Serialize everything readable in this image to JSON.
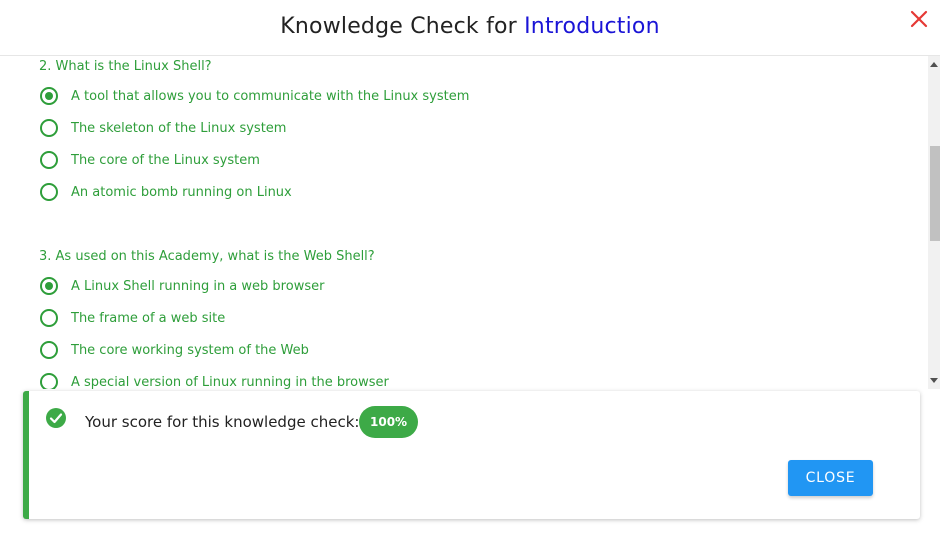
{
  "header": {
    "title_prefix": "Knowledge Check for ",
    "title_accent": "Introduction",
    "close_icon": "close-icon"
  },
  "questions": [
    {
      "text": "2. What is the Linux Shell?",
      "options": [
        {
          "label": "A tool that allows you to communicate with the Linux system",
          "checked": true
        },
        {
          "label": "The skeleton of the Linux system",
          "checked": false
        },
        {
          "label": "The core of the Linux system",
          "checked": false
        },
        {
          "label": "An atomic bomb running on Linux",
          "checked": false
        }
      ]
    },
    {
      "text": "3. As used on this Academy, what is the Web Shell?",
      "options": [
        {
          "label": "A Linux Shell running in a web browser",
          "checked": true
        },
        {
          "label": "The frame of a web site",
          "checked": false
        },
        {
          "label": "The core working system of the Web",
          "checked": false
        },
        {
          "label": "A special version of Linux running in the browser",
          "checked": false
        }
      ]
    }
  ],
  "result": {
    "icon": "check-circle-icon",
    "score_text": "Your score for this knowledge check:",
    "score_value": "100%",
    "close_label": "CLOSE"
  },
  "colors": {
    "accent_blue": "#1a14d6",
    "green": "#2e9e3a",
    "badge_green": "#3daa47",
    "button_blue": "#2196f3",
    "close_red": "#e53935"
  }
}
